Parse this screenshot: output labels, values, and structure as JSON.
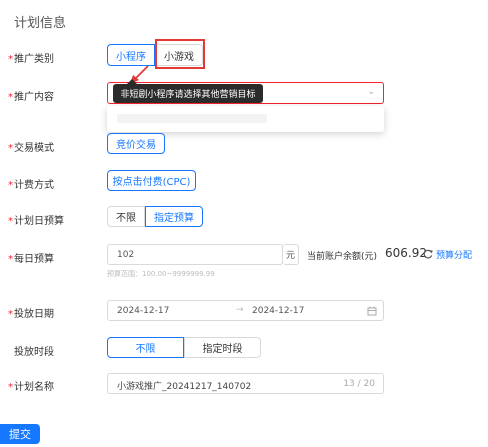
{
  "section_title": "计划信息",
  "promotion_type": {
    "label": "推广类别",
    "options": [
      "小程序",
      "小游戏"
    ],
    "selected": "小程序"
  },
  "promotion_content": {
    "label": "推广内容",
    "tooltip": "非短剧小程序请选择其他营销目标"
  },
  "trade_mode": {
    "label": "交易模式",
    "value": "竞价交易"
  },
  "billing": {
    "label": "计费方式",
    "value": "按点击付费(CPC)"
  },
  "plan_budget": {
    "label": "计划日预算",
    "options": [
      "不限",
      "指定预算"
    ],
    "selected": "指定预算"
  },
  "daily_budget": {
    "label": "每日预算",
    "value": "102",
    "unit": "元",
    "hint": "预算范围：100.00~9999999.99",
    "balance_label": "当前账户余额(元)",
    "balance_value": "606.92",
    "allocate_label": "预算分配"
  },
  "schedule_date": {
    "label": "投放日期",
    "start": "2024-12-17",
    "end": "2024-12-17",
    "arrow": "→"
  },
  "schedule_time": {
    "label": "投放时段",
    "options": [
      "不限",
      "指定时段"
    ],
    "selected": "不限"
  },
  "plan_name": {
    "label": "计划名称",
    "value": "小游戏推广_20241217_140702",
    "counter": "13 / 20"
  },
  "submit_label": "提交",
  "required_mark": "*",
  "colors": {
    "primary": "#1677ff",
    "error": "#f5222d",
    "tooltip_bg": "#2b2b2b"
  },
  "icons": {
    "dropdown": "chevron-down-icon",
    "calendar": "calendar-icon",
    "refresh": "refresh-icon"
  }
}
